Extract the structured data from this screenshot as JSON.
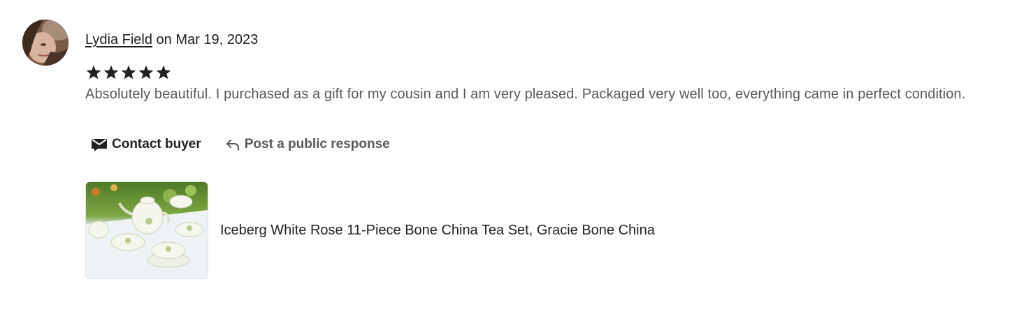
{
  "review": {
    "reviewer_name": "Lydia Field",
    "date_text": "on Mar 19, 2023",
    "rating": 5,
    "max_rating": 5,
    "text": "Absolutely beautiful. I purchased as a gift for my cousin and I am very pleased. Packaged very well too, everything came in perfect condition."
  },
  "actions": {
    "contact_label": "Contact buyer",
    "respond_label": "Post a public response"
  },
  "listing": {
    "title": "Iceberg White Rose 11-Piece Bone China Tea Set, Gracie Bone China"
  },
  "icons": {
    "star": "star-icon",
    "contact": "envelope-icon",
    "respond": "reply-arrow-icon"
  },
  "colors": {
    "text_primary": "#222222",
    "text_secondary": "#595959",
    "star": "#222222"
  }
}
